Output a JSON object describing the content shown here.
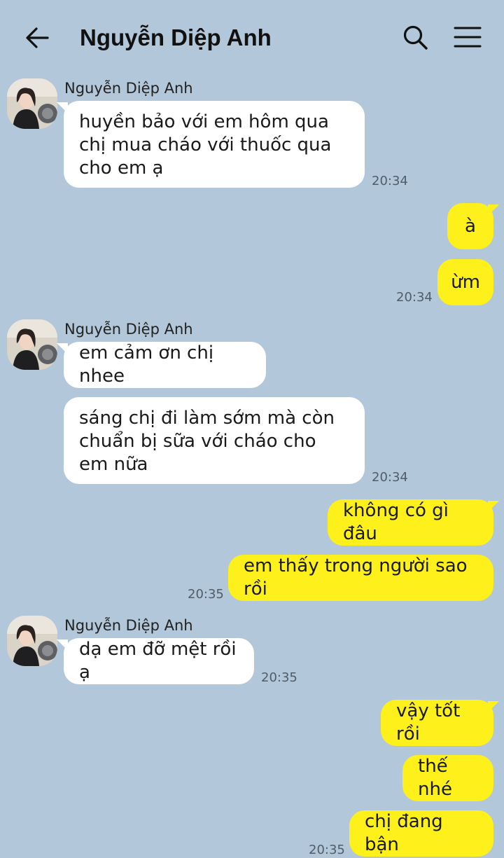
{
  "header": {
    "title": "Nguyễn Diệp Anh"
  },
  "icons": {
    "back": "arrow-left-icon",
    "search": "search-icon",
    "menu": "hamburger-menu-icon"
  },
  "colors": {
    "background": "#b2c7d9",
    "incoming_bubble": "#ffffff",
    "outgoing_bubble": "#fef01b"
  },
  "messages": [
    {
      "sender": "Nguyễn Diệp Anh",
      "text": "huyền bảo với em hôm qua chị mua cháo với thuốc qua cho em ạ",
      "time": "20:34"
    },
    {
      "text": "à"
    },
    {
      "text": "ừm",
      "time": "20:34"
    },
    {
      "sender": "Nguyễn Diệp Anh",
      "text": "em cảm ơn chị nhee"
    },
    {
      "text": "sáng chị đi làm sớm mà còn chuẩn bị sữa với cháo cho em nữa",
      "time": "20:34"
    },
    {
      "text": "không có gì đâu"
    },
    {
      "text": "em thấy trong người sao rồi",
      "time": "20:35"
    },
    {
      "sender": "Nguyễn Diệp Anh",
      "text": "dạ em đỡ mệt rồi ạ",
      "time": "20:35"
    },
    {
      "text": "vậy tốt rồi"
    },
    {
      "text": "thế nhé"
    },
    {
      "text": "chị đang bận",
      "time": "20:35"
    }
  ]
}
